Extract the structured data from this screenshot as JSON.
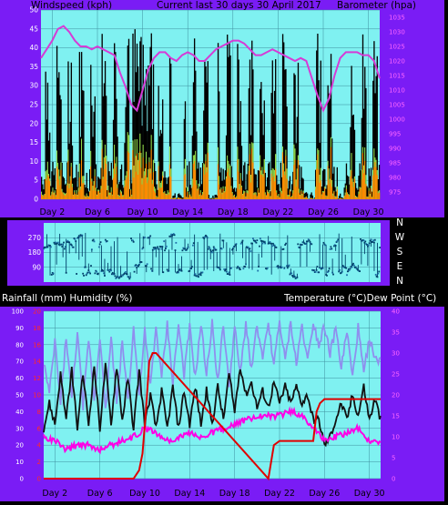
{
  "colors": {
    "bg": "#7a1cf5",
    "plot": "#7ff1f1",
    "grid": "#3f8f9f",
    "windspeed_max": "#000000",
    "windspeed_avg": "#8ed84a",
    "windspeed_bar": "#ff8a00",
    "barometer": "#d63bd6",
    "wind_dir": "#00406a",
    "wind_dir_light": "#1e6fa8",
    "rainfall": "#e00000",
    "humidity": "#8f8fee",
    "temperature": "#111111",
    "dew_point": "#ff00e6",
    "tick_label_left": "#ffffff",
    "tick_label_red": "#ff2a2a",
    "tick_label_right": "#ff66ff"
  },
  "chart_data": [
    {
      "id": "wind-pressure",
      "type": "line",
      "title": "Current last 30 days 30 April 2017",
      "left_label": "Windspeed (kph)",
      "right_label": "Barometer (hpa)",
      "x_labels": [
        "Day 2",
        "Day 6",
        "Day 10",
        "Day 14",
        "Day 18",
        "Day 22",
        "Day 26",
        "Day 30"
      ],
      "x_label_days": [
        2,
        6,
        10,
        14,
        18,
        22,
        26,
        30
      ],
      "xlim": [
        1,
        31
      ],
      "ylim_left": [
        0,
        50
      ],
      "ylim_right": [
        972.5,
        1037.5
      ],
      "left_ticks": [
        0,
        5,
        10,
        15,
        20,
        25,
        30,
        35,
        40,
        45,
        50
      ],
      "right_ticks": [
        975,
        980,
        985,
        990,
        995,
        1000,
        1005,
        1010,
        1015,
        1020,
        1025,
        1030,
        1035
      ],
      "series": [
        {
          "name": "Barometer",
          "x": [
            1,
            1.5,
            2,
            2.5,
            3,
            3.5,
            4,
            4.5,
            5,
            5.5,
            6,
            6.5,
            7,
            7.5,
            8,
            8.5,
            9,
            9.5,
            10,
            10.5,
            11,
            11.5,
            12,
            12.5,
            13,
            13.5,
            14,
            14.5,
            15,
            15.5,
            16,
            16.5,
            17,
            17.5,
            18,
            18.5,
            19,
            19.5,
            20,
            20.5,
            21,
            21.5,
            22,
            22.5,
            23,
            23.5,
            24,
            24.5,
            25,
            25.5,
            26,
            26.5,
            27,
            27.5,
            28,
            28.5,
            29,
            29.5,
            30,
            30.5,
            31
          ],
          "y": [
            1021,
            1024,
            1027,
            1031,
            1032,
            1030,
            1027,
            1025,
            1025,
            1024,
            1025,
            1024,
            1023,
            1022,
            1016,
            1011,
            1005,
            1003,
            1010,
            1017,
            1021,
            1023,
            1023,
            1021,
            1020,
            1022,
            1023,
            1022,
            1020,
            1020,
            1022,
            1024,
            1025,
            1026,
            1027,
            1027,
            1026,
            1024,
            1022,
            1022,
            1023,
            1024,
            1023,
            1022,
            1021,
            1020,
            1021,
            1020,
            1014,
            1008,
            1003,
            1007,
            1015,
            1021,
            1023,
            1023,
            1023,
            1022,
            1022,
            1020,
            1014
          ]
        }
      ]
    },
    {
      "id": "wind-direction",
      "type": "scatter",
      "left_ticks": [
        90,
        180,
        270
      ],
      "ylim": [
        0,
        360
      ],
      "xlim": [
        1,
        31
      ],
      "right_labels": [
        "N",
        "W",
        "S",
        "E",
        "N"
      ]
    },
    {
      "id": "rain-humidity-temp",
      "type": "line",
      "title_left": "Rainfall (mm)  Humidity (%)",
      "title_right": "Temperature (°C)Dew Point (°C)",
      "x_labels": [
        "Day 2",
        "Day 6",
        "Day 10",
        "Day 14",
        "Day 18",
        "Day 22",
        "Day 26",
        "Day 30"
      ],
      "x_label_days": [
        2,
        6,
        10,
        14,
        18,
        22,
        26,
        30
      ],
      "xlim": [
        1,
        31
      ],
      "humidity_ticks": [
        0,
        10,
        20,
        30,
        40,
        50,
        60,
        70,
        80,
        90,
        100
      ],
      "rain_ticks": [
        0,
        2,
        4,
        6,
        8,
        10,
        12,
        14,
        16,
        18,
        20
      ],
      "temp_ticks": [
        0,
        5,
        10,
        15,
        20,
        25,
        30,
        35,
        40
      ],
      "ylim_humidity": [
        0,
        100
      ],
      "ylim_rain": [
        0,
        20
      ],
      "ylim_temp": [
        0,
        40
      ],
      "series": [
        {
          "name": "Rainfall",
          "x": [
            1,
            9,
            9.5,
            9.8,
            10.1,
            10.4,
            10.7,
            11,
            21,
            21.5,
            22,
            25,
            25.3,
            25.6,
            26,
            26.5,
            27,
            31
          ],
          "y": [
            0,
            0,
            1,
            3,
            8,
            14,
            15,
            15,
            0,
            4,
            4.5,
            4.5,
            8,
            9,
            9.5,
            9.5,
            9.5,
            9.5
          ]
        },
        {
          "name": "Temperature",
          "x": [
            1,
            1.5,
            2,
            2.5,
            3,
            3.5,
            4,
            4.5,
            5,
            5.5,
            6,
            6.5,
            7,
            7.5,
            8,
            8.5,
            9,
            9.5,
            10,
            10.5,
            11,
            11.5,
            12,
            12.5,
            13,
            13.5,
            14,
            14.5,
            15,
            15.5,
            16,
            16.5,
            17,
            17.5,
            18,
            18.5,
            19,
            19.5,
            20,
            20.5,
            21,
            21.5,
            22,
            22.5,
            23,
            23.5,
            24,
            24.5,
            25,
            25.5,
            26,
            26.5,
            27,
            27.5,
            28,
            28.5,
            29,
            29.5,
            30,
            30.5,
            31
          ],
          "y": [
            12,
            18,
            13,
            25,
            14,
            26,
            12,
            25,
            13,
            27,
            12,
            27,
            13,
            27,
            14,
            24,
            12,
            26,
            13,
            20,
            12,
            21,
            12,
            22,
            12,
            21,
            13,
            22,
            13,
            21,
            13,
            22,
            14,
            25,
            16,
            27,
            20,
            23,
            17,
            21,
            17,
            23,
            18,
            22,
            18,
            22,
            18,
            20,
            14,
            14,
            8,
            10,
            14,
            18,
            14,
            20,
            15,
            22,
            14,
            19,
            14
          ]
        },
        {
          "name": "Dew Point",
          "x": [
            1,
            2,
            3,
            4,
            5,
            6,
            7,
            8,
            9,
            10,
            11,
            12,
            13,
            14,
            15,
            16,
            17,
            18,
            19,
            20,
            21,
            22,
            23,
            24,
            25,
            26,
            27,
            28,
            29,
            30,
            31
          ],
          "y": [
            10,
            9,
            7,
            8,
            8,
            7,
            8,
            9,
            10,
            12,
            11,
            9,
            10,
            11,
            10,
            11,
            12,
            13,
            14,
            15,
            15,
            15,
            16,
            15,
            12,
            9,
            10,
            11,
            12,
            9,
            9
          ]
        },
        {
          "name": "Humidity",
          "x": [
            1,
            1.5,
            2,
            2.5,
            3,
            3.5,
            4,
            4.5,
            5,
            5.5,
            6,
            6.5,
            7,
            7.5,
            8,
            8.5,
            9,
            9.5,
            10,
            10.5,
            11,
            11.5,
            12,
            12.5,
            13,
            13.5,
            14,
            14.5,
            15,
            15.5,
            16,
            16.5,
            17,
            17.5,
            18,
            18.5,
            19,
            19.5,
            20,
            20.5,
            21,
            21.5,
            22,
            22.5,
            23,
            23.5,
            24,
            24.5,
            25,
            25.5,
            26,
            26.5,
            27,
            27.5,
            28,
            28.5,
            29,
            29.5,
            30,
            30.5,
            31
          ],
          "y": [
            70,
            50,
            82,
            45,
            85,
            48,
            88,
            42,
            84,
            47,
            86,
            40,
            85,
            45,
            82,
            47,
            90,
            50,
            88,
            55,
            90,
            60,
            92,
            58,
            92,
            62,
            90,
            60,
            92,
            62,
            93,
            58,
            92,
            55,
            90,
            62,
            93,
            65,
            92,
            70,
            93,
            68,
            94,
            70,
            93,
            68,
            92,
            70,
            94,
            80,
            92,
            74,
            90,
            66,
            88,
            60,
            90,
            62,
            85,
            70,
            72
          ]
        }
      ]
    }
  ]
}
